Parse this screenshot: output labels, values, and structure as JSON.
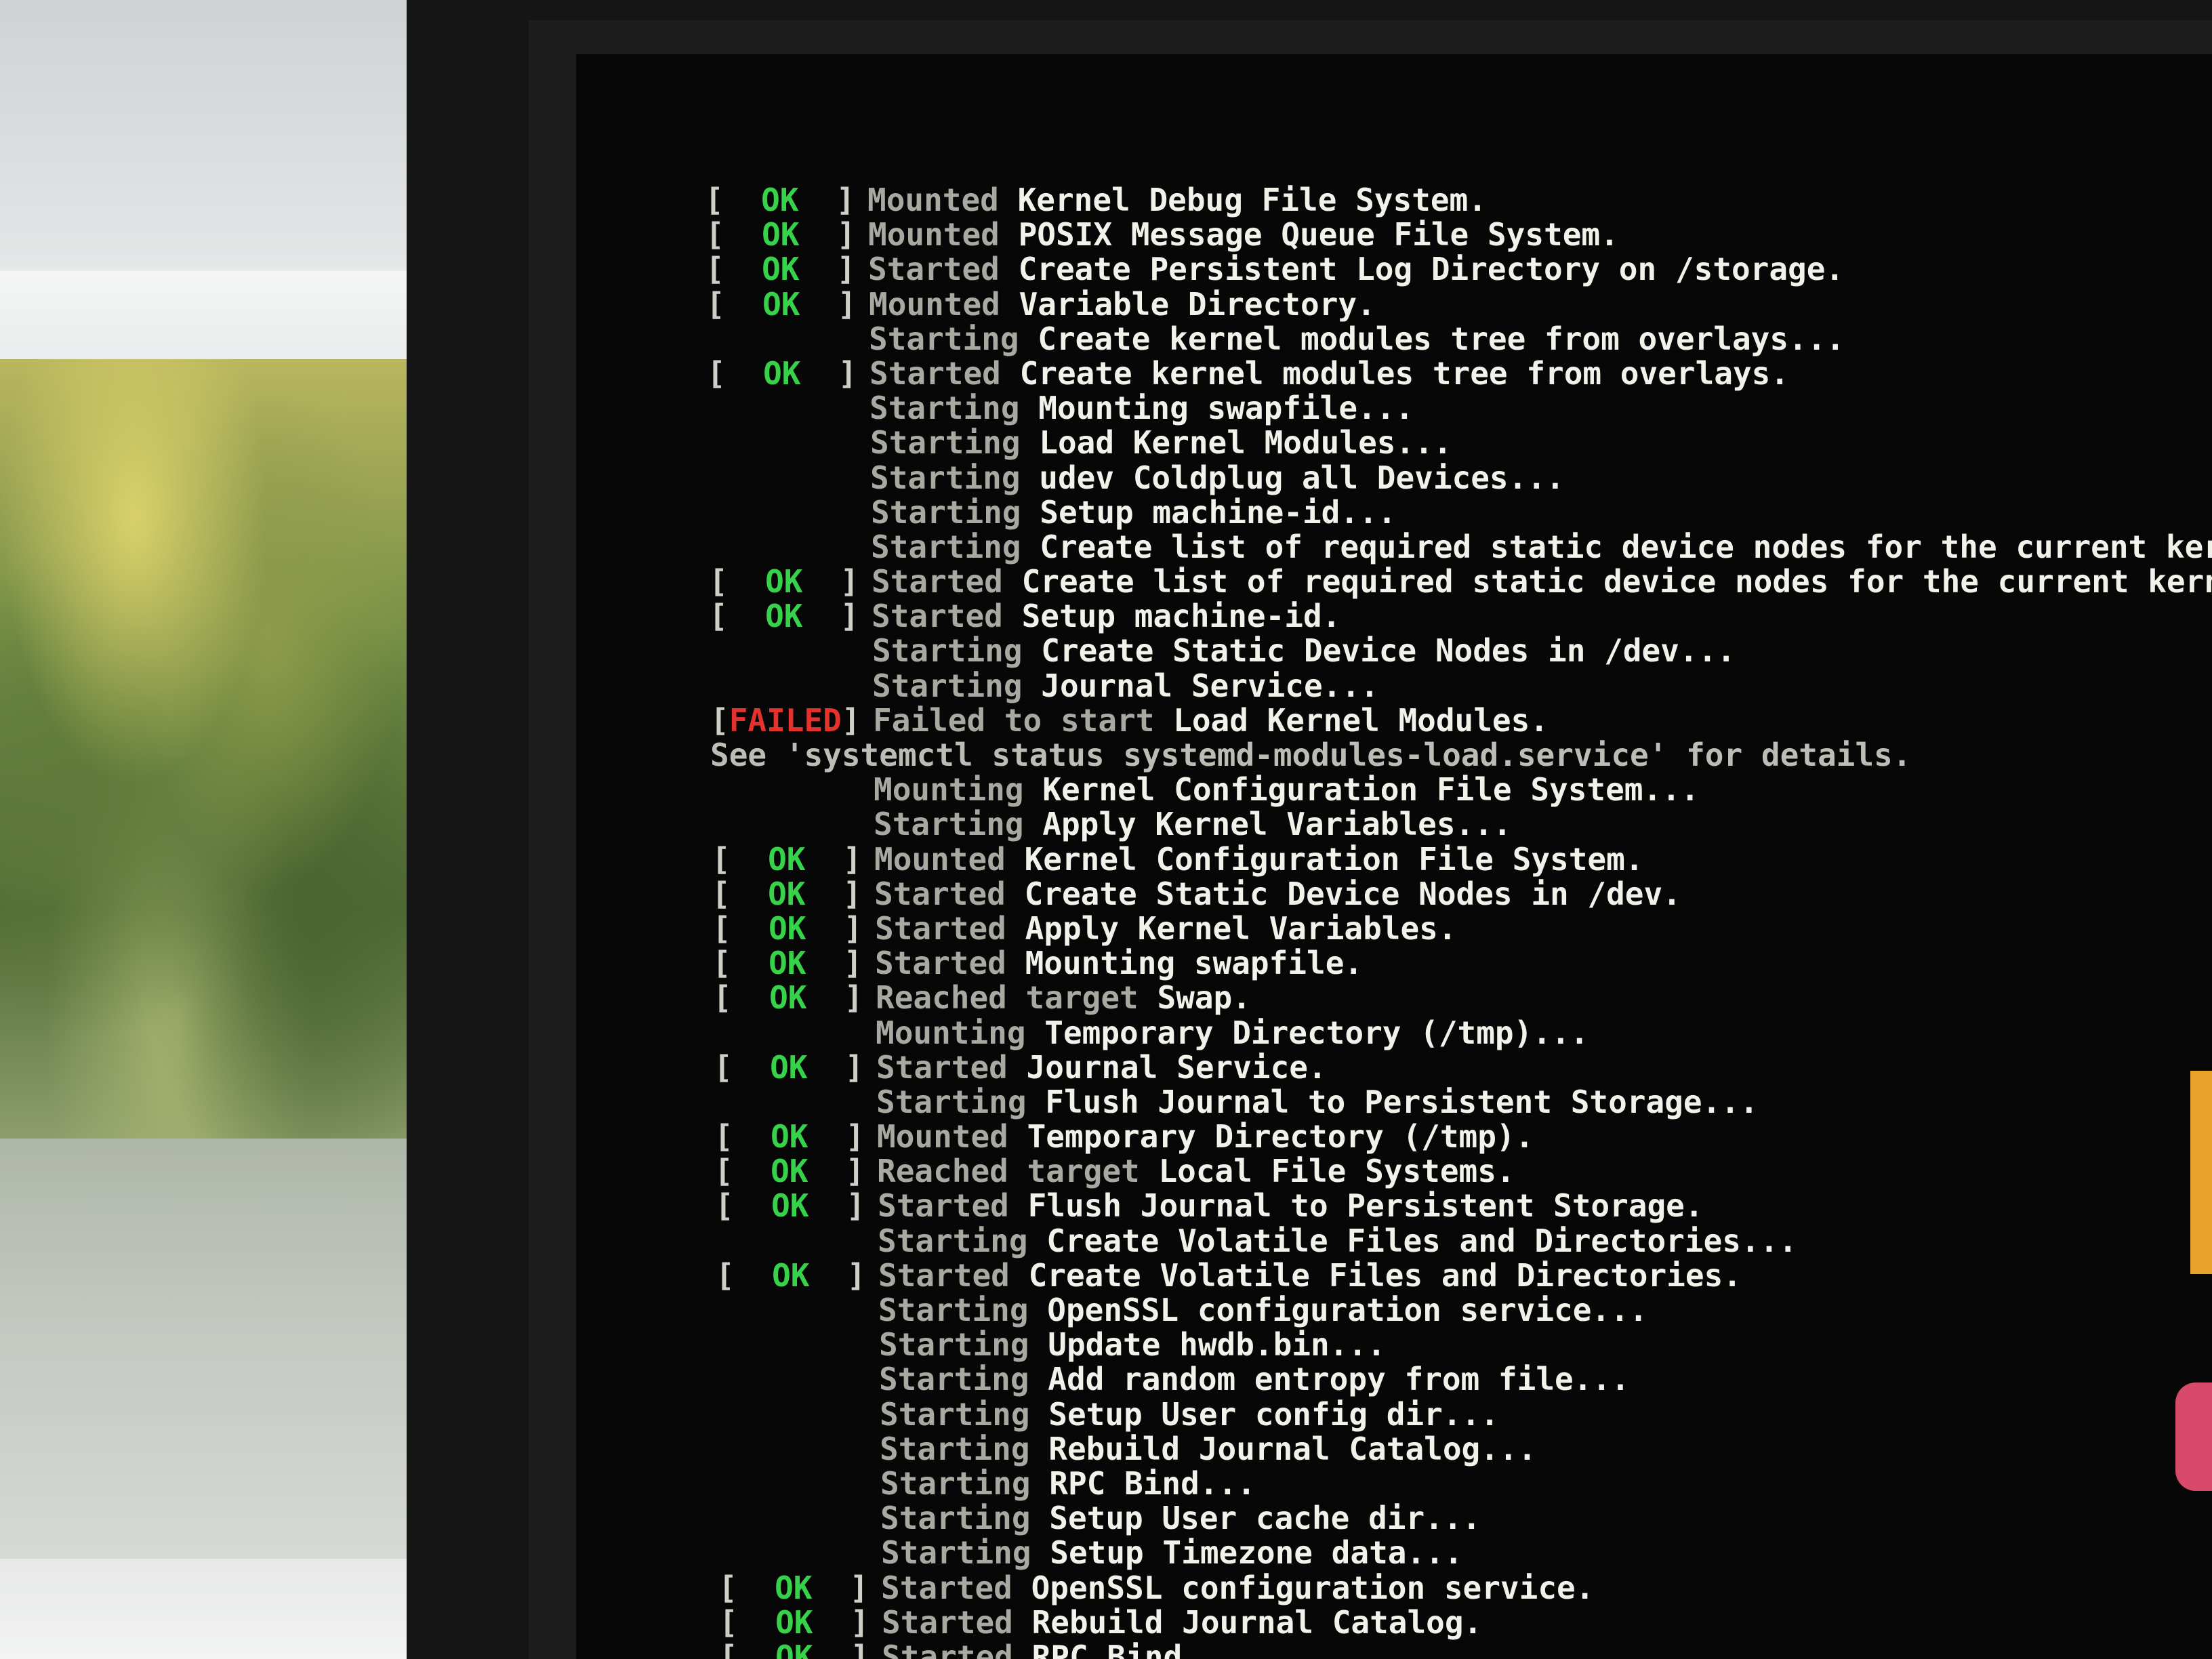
{
  "boot_log": {
    "lines": [
      {
        "status": "OK",
        "verb": "Mounted",
        "text": "Kernel Debug File System."
      },
      {
        "status": "OK",
        "verb": "Mounted",
        "text": "POSIX Message Queue File System."
      },
      {
        "status": "OK",
        "verb": "Started",
        "text": "Create Persistent Log Directory on /storage."
      },
      {
        "status": "OK",
        "verb": "Mounted",
        "text": "Variable Directory."
      },
      {
        "status": "",
        "verb": "Starting",
        "text": "Create kernel modules tree from overlays..."
      },
      {
        "status": "OK",
        "verb": "Started",
        "text": "Create kernel modules tree from overlays."
      },
      {
        "status": "",
        "verb": "Starting",
        "text": "Mounting swapfile..."
      },
      {
        "status": "",
        "verb": "Starting",
        "text": "Load Kernel Modules..."
      },
      {
        "status": "",
        "verb": "Starting",
        "text": "udev Coldplug all Devices..."
      },
      {
        "status": "",
        "verb": "Starting",
        "text": "Setup machine-id..."
      },
      {
        "status": "",
        "verb": "Starting",
        "text": "Create list of required static device nodes for the current kernel."
      },
      {
        "status": "OK",
        "verb": "Started",
        "text": "Create list of required static device nodes for the current kernel."
      },
      {
        "status": "OK",
        "verb": "Started",
        "text": "Setup machine-id."
      },
      {
        "status": "",
        "verb": "Starting",
        "text": "Create Static Device Nodes in /dev..."
      },
      {
        "status": "",
        "verb": "Starting",
        "text": "Journal Service..."
      },
      {
        "status": "FAILED",
        "verb": "Failed to start",
        "text": "Load Kernel Modules."
      },
      {
        "status": "note",
        "verb": "",
        "text": "See 'systemctl status systemd-modules-load.service' for details."
      },
      {
        "status": "",
        "verb": "Mounting",
        "text": "Kernel Configuration File System..."
      },
      {
        "status": "",
        "verb": "Starting",
        "text": "Apply Kernel Variables..."
      },
      {
        "status": "OK",
        "verb": "Mounted",
        "text": "Kernel Configuration File System."
      },
      {
        "status": "OK",
        "verb": "Started",
        "text": "Create Static Device Nodes in /dev."
      },
      {
        "status": "OK",
        "verb": "Started",
        "text": "Apply Kernel Variables."
      },
      {
        "status": "OK",
        "verb": "Started",
        "text": "Mounting swapfile."
      },
      {
        "status": "OK",
        "verb": "Reached target",
        "text": "Swap."
      },
      {
        "status": "",
        "verb": "Mounting",
        "text": "Temporary Directory (/tmp)..."
      },
      {
        "status": "OK",
        "verb": "Started",
        "text": "Journal Service."
      },
      {
        "status": "",
        "verb": "Starting",
        "text": "Flush Journal to Persistent Storage..."
      },
      {
        "status": "OK",
        "verb": "Mounted",
        "text": "Temporary Directory (/tmp)."
      },
      {
        "status": "OK",
        "verb": "Reached target",
        "text": "Local File Systems."
      },
      {
        "status": "OK",
        "verb": "Started",
        "text": "Flush Journal to Persistent Storage."
      },
      {
        "status": "",
        "verb": "Starting",
        "text": "Create Volatile Files and Directories..."
      },
      {
        "status": "OK",
        "verb": "Started",
        "text": "Create Volatile Files and Directories."
      },
      {
        "status": "",
        "verb": "Starting",
        "text": "OpenSSL configuration service..."
      },
      {
        "status": "",
        "verb": "Starting",
        "text": "Update hwdb.bin..."
      },
      {
        "status": "",
        "verb": "Starting",
        "text": "Add random entropy from file..."
      },
      {
        "status": "",
        "verb": "Starting",
        "text": "Setup User config dir..."
      },
      {
        "status": "",
        "verb": "Starting",
        "text": "Rebuild Journal Catalog..."
      },
      {
        "status": "",
        "verb": "Starting",
        "text": "RPC Bind..."
      },
      {
        "status": "",
        "verb": "Starting",
        "text": "Setup User cache dir..."
      },
      {
        "status": "",
        "verb": "Starting",
        "text": "Setup Timezone data..."
      },
      {
        "status": "OK",
        "verb": "Started",
        "text": "OpenSSL configuration service."
      },
      {
        "status": "OK",
        "verb": "Started",
        "text": "Rebuild Journal Catalog."
      },
      {
        "status": "OK",
        "verb": "Started",
        "text": "RPC Bind."
      }
    ]
  },
  "colors": {
    "ok": "#36d34a",
    "failed": "#e4322c",
    "text": "#f2f2ea",
    "background": "#070707"
  }
}
